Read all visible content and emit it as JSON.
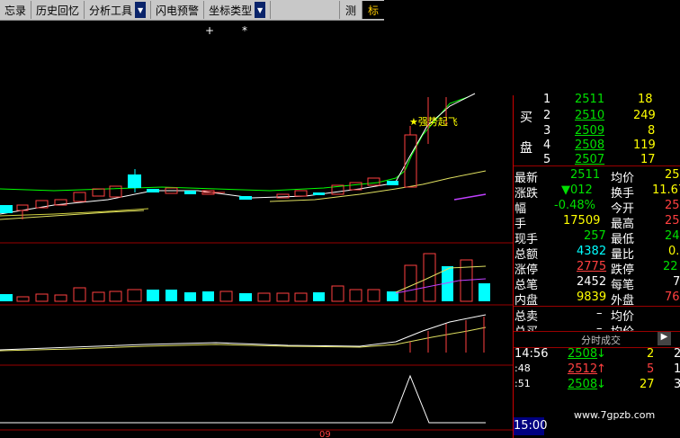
{
  "toolbar": {
    "items": [
      "忘录",
      "历史回忆",
      "分析工具",
      "闪电预警",
      "坐标类型"
    ],
    "right": [
      "测",
      "标"
    ]
  },
  "chart_marks": {
    "signal_label": "★强势起飞",
    "bottom_label": "09",
    "plus": "+",
    "asterisk": "*"
  },
  "order_book": {
    "buy_label_1": "买",
    "buy_label_2": "盘",
    "rows": [
      {
        "level": "1",
        "price": "2511",
        "volume": "18"
      },
      {
        "level": "2",
        "price": "2510",
        "volume": "249"
      },
      {
        "level": "3",
        "price": "2509",
        "volume": "8"
      },
      {
        "level": "4",
        "price": "2508",
        "volume": "119"
      },
      {
        "level": "5",
        "price": "2507",
        "volume": "17"
      }
    ]
  },
  "quote": {
    "latest_label": "最新",
    "latest": "2511",
    "avg_label": "均价",
    "avg": "25",
    "change_label": "涨跌",
    "change": "▼012",
    "turnover_label": "换手",
    "turnover": "11.67",
    "pct_label": "幅",
    "pct": "-0.48%",
    "open_label": "今开",
    "open": "25",
    "total_hands_label": "手",
    "total_hands": "17509",
    "high_label": "最高",
    "high": "25",
    "now_hands_label": "现手",
    "now_hands": "257",
    "low_label": "最低",
    "low": "24",
    "amount_label": "总额",
    "amount": "4382",
    "vol_ratio_label": "量比",
    "vol_ratio": "0.",
    "limit_up_label": "涨停",
    "limit_up": "2775",
    "limit_down_label": "跌停",
    "limit_down": "22",
    "trades_label": "总笔",
    "trades": "2452",
    "per_trade_label": "每笔",
    "per_trade": "7",
    "inner_label": "内盘",
    "inner": "9839",
    "outer_label": "外盘",
    "outer": "76",
    "total_sell_label": "总卖",
    "total_sell": "–",
    "sell_avg_label": "均价",
    "total_buy_label": "总买",
    "total_buy": "–",
    "buy_avg_label": "均价"
  },
  "ticks": {
    "header": "分时成交",
    "arrow": "▶",
    "rows": [
      {
        "time": "14:56",
        "price": "2508",
        "dir": "↓",
        "vol": "2",
        "extra": "2"
      },
      {
        "time": ":48",
        "price": "2512",
        "dir": "↑",
        "vol": "5",
        "extra": "1"
      },
      {
        "time": ":51",
        "price": "2508",
        "dir": "↓",
        "vol": "27",
        "extra": "3"
      }
    ],
    "current_time": "15:00"
  },
  "watermark": "www.7gpzb.com"
}
